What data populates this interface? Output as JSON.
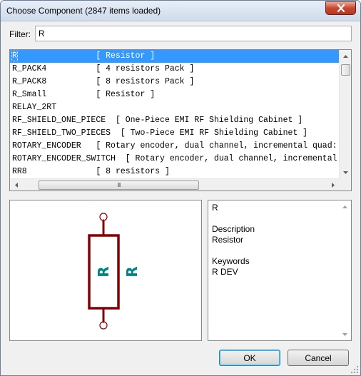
{
  "window": {
    "title": "Choose Component (2847 items loaded)"
  },
  "filter": {
    "label": "Filter:",
    "value": "R"
  },
  "components": [
    {
      "name": "R",
      "description": "[ Resistor ]",
      "selected": true
    },
    {
      "name": "R_PACK4",
      "description": "[ 4 resistors Pack ]"
    },
    {
      "name": "R_PACK8",
      "description": "[ 8 resistors Pack ]"
    },
    {
      "name": "R_Small",
      "description": "[ Resistor ]"
    },
    {
      "name": "RELAY_2RT",
      "description": ""
    },
    {
      "name": "RF_SHIELD_ONE_PIECE",
      "description": "[ One-Piece EMI RF Shielding Cabinet ]"
    },
    {
      "name": "RF_SHIELD_TWO_PIECES",
      "description": "[ Two-Piece EMI RF Shielding Cabinet ]"
    },
    {
      "name": "ROTARY_ENCODER",
      "description": "[ Rotary encoder, dual channel, incremental quad:"
    },
    {
      "name": "ROTARY_ENCODER_SWITCH",
      "description": "[ Rotary encoder, dual channel, incremental"
    },
    {
      "name": "RR8",
      "description": "[ 8 resistors ]"
    }
  ],
  "scrollbar_grip": "III",
  "preview": {
    "reference": "R",
    "value": "R",
    "symbol_color": "#840000",
    "text_color": "#008484"
  },
  "info": {
    "name": "R",
    "description_heading": "Description",
    "description": "Resistor",
    "keywords_heading": "Keywords",
    "keywords": "R DEV"
  },
  "buttons": {
    "ok": "OK",
    "cancel": "Cancel"
  }
}
